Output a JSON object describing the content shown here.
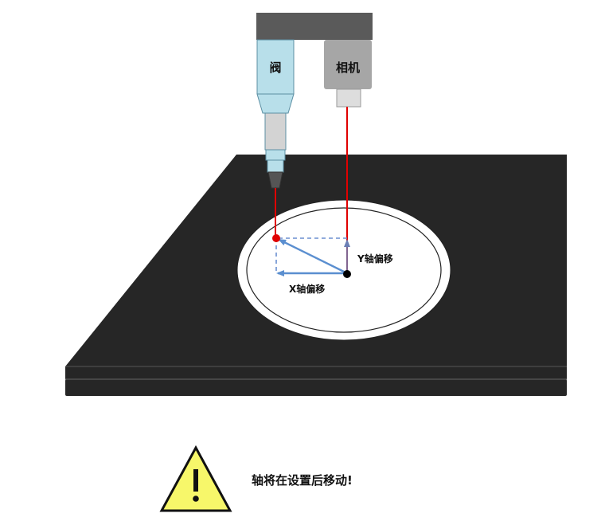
{
  "diagram": {
    "valve_label": "阀",
    "camera_label": "相机",
    "x_offset_label": "X轴偏移",
    "y_offset_label": "Y轴偏移"
  },
  "warning": {
    "text": "轴将在设置后移动!",
    "icon": "warning-triangle-icon"
  },
  "colors": {
    "platform": "#262626",
    "gantry": "#5a5a5a",
    "valve": "#b8dfea",
    "camera": "#a6a6a6",
    "laser": "#e00000",
    "arrow": "#5b8fd0",
    "warning_fill": "#f7f76a"
  }
}
